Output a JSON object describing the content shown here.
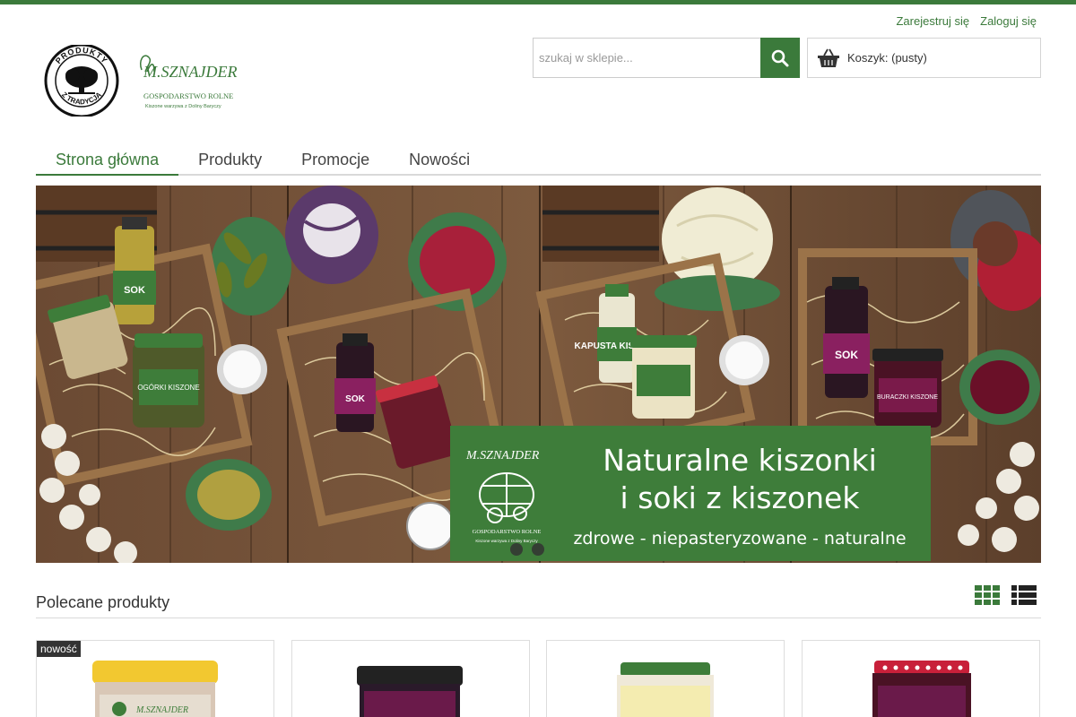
{
  "header": {
    "register_label": "Zarejestruj się",
    "login_label": "Zaloguj się",
    "logo_left_top": "PRODUKTY",
    "logo_left_bottom": "Z TRADYCJĄ",
    "logo_brand": "M.SZNAJDER",
    "logo_brand_sub": "GOSPODARSTWO ROLNE",
    "logo_brand_tagline": "Kiszone warzywa z Doliny Baryczy"
  },
  "search": {
    "placeholder": "szukaj w sklepie...",
    "value": ""
  },
  "cart": {
    "label": "Koszyk: (pusty)"
  },
  "nav": {
    "items": [
      {
        "label": "Strona główna"
      },
      {
        "label": "Produkty"
      },
      {
        "label": "Promocje"
      },
      {
        "label": "Nowości"
      }
    ]
  },
  "hero": {
    "banner_line1": "Naturalne kiszonki",
    "banner_line2": "i soki z kiszonek",
    "banner_tagline": "zdrowe - niepasteryzowane - naturalne",
    "banner_brand": "M.SZNAJDER",
    "banner_brand_sub": "GOSPODARSTWO ROLNE",
    "banner_brand_tagline": "Kiszone warzywa z Doliny Baryczy",
    "jar_labels": [
      "SOK",
      "OGÓRKI KISZONE",
      "SOK",
      "KAPUSTA KISZONA",
      "SOK",
      "BURACZKI KISZONE"
    ],
    "slide_count": 2,
    "active_slide": 1
  },
  "products": {
    "section_title": "Polecane produkty",
    "badge_new": "nowość",
    "card_brand": "M.SZNAJDER"
  },
  "colors": {
    "accent": "#3b7a3b",
    "banner_green": "#3e7d3a"
  }
}
